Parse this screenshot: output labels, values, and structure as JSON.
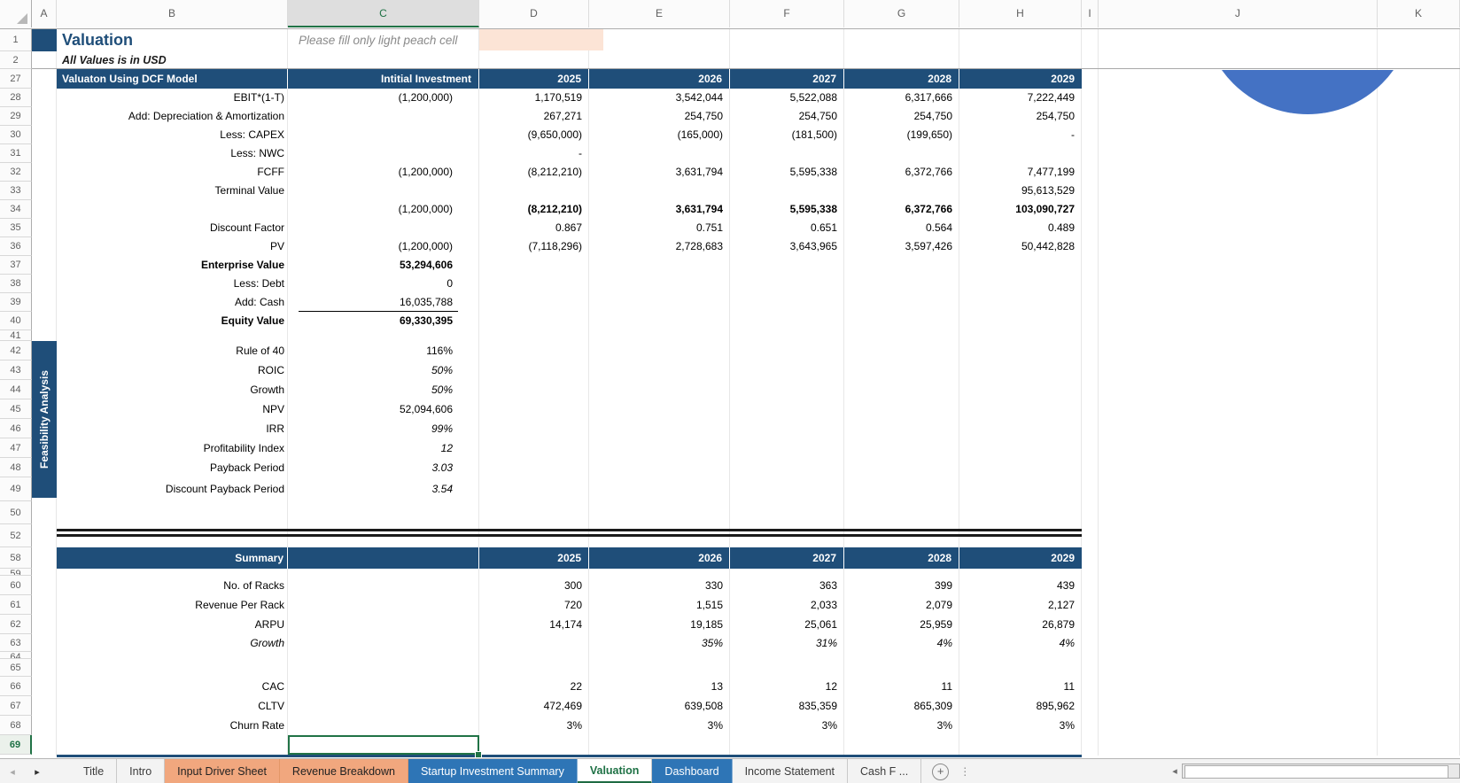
{
  "sheet": {
    "title": "Valuation",
    "subtitle": "All Values is in USD",
    "note": "Please fill only light peach cell",
    "column_headers": [
      "A",
      "B",
      "C",
      "D",
      "E",
      "F",
      "G",
      "H",
      "I",
      "J",
      "K"
    ],
    "selected_column": "C",
    "row_numbers": [
      "1",
      "2",
      "27",
      "28",
      "29",
      "30",
      "31",
      "32",
      "33",
      "34",
      "35",
      "36",
      "37",
      "38",
      "39",
      "40",
      "41",
      "42",
      "43",
      "44",
      "45",
      "46",
      "47",
      "48",
      "49",
      "50",
      "52",
      "58",
      "59",
      "60",
      "61",
      "62",
      "63",
      "64",
      "65",
      "66",
      "67",
      "68",
      "69"
    ],
    "selected_row": "69",
    "sidebar_label": "Feasibility Analysis"
  },
  "dcf_table": {
    "title": "Valuaton Using DCF Model",
    "initial_col_header": "Intitial Investment",
    "years": [
      "2025",
      "2026",
      "2027",
      "2028",
      "2029"
    ],
    "rows": [
      {
        "label": "EBIT*(1-T)",
        "initial": "(1,200,000)",
        "values": [
          "1,170,519",
          "3,542,044",
          "5,522,088",
          "6,317,666",
          "7,222,449"
        ]
      },
      {
        "label": "Add: Depreciation & Amortization",
        "initial": "",
        "values": [
          "267,271",
          "254,750",
          "254,750",
          "254,750",
          "254,750"
        ]
      },
      {
        "label": "Less: CAPEX",
        "initial": "",
        "values": [
          "(9,650,000)",
          "(165,000)",
          "(181,500)",
          "(199,650)",
          "-"
        ]
      },
      {
        "label": "Less: NWC",
        "initial": "",
        "values": [
          "-",
          "",
          "",
          "",
          ""
        ]
      },
      {
        "label": "FCFF",
        "initial": "(1,200,000)",
        "values": [
          "(8,212,210)",
          "3,631,794",
          "5,595,338",
          "6,372,766",
          "7,477,199"
        ]
      },
      {
        "label": "Terminal Value",
        "initial": "",
        "values": [
          "",
          "",
          "",
          "",
          "95,613,529"
        ]
      },
      {
        "label": "",
        "initial": "(1,200,000)",
        "values": [
          "(8,212,210)",
          "3,631,794",
          "5,595,338",
          "6,372,766",
          "103,090,727"
        ],
        "bold_values": true
      },
      {
        "label": "Discount Factor",
        "initial": "",
        "values": [
          "0.867",
          "0.751",
          "0.651",
          "0.564",
          "0.489"
        ]
      },
      {
        "label": "PV",
        "initial": "(1,200,000)",
        "values": [
          "(7,118,296)",
          "2,728,683",
          "3,643,965",
          "3,597,426",
          "50,442,828"
        ]
      }
    ]
  },
  "valuation_metrics": [
    {
      "label": "Enterprise Value",
      "value": "53,294,606",
      "bold": true
    },
    {
      "label": "Less: Debt",
      "value": "0"
    },
    {
      "label": "Add: Cash",
      "value": "16,035,788"
    },
    {
      "label": "Equity Value",
      "value": "69,330,395",
      "bold": true
    }
  ],
  "feasibility_metrics": [
    {
      "label": "Rule of 40",
      "value": "116%"
    },
    {
      "label": "ROIC",
      "value": "50%",
      "italic": true
    },
    {
      "label": "Growth",
      "value": "50%",
      "italic": true
    },
    {
      "label": "NPV",
      "value": "52,094,606"
    },
    {
      "label": "IRR",
      "value": "99%",
      "italic": true
    },
    {
      "label": "Profitability Index",
      "value": "12",
      "italic": true
    },
    {
      "label": "Payback Period",
      "value": "3.03",
      "italic": true
    },
    {
      "label": "Discount Payback Period",
      "value": "3.54",
      "italic": true
    }
  ],
  "summary_table": {
    "title": "Summary",
    "years": [
      "2025",
      "2026",
      "2027",
      "2028",
      "2029"
    ],
    "rows": [
      {
        "label": "No. of Racks",
        "values": [
          "300",
          "330",
          "363",
          "399",
          "439"
        ]
      },
      {
        "label": "Revenue Per Rack",
        "values": [
          "720",
          "1,515",
          "2,033",
          "2,079",
          "2,127"
        ]
      },
      {
        "label": "ARPU",
        "values": [
          "14,174",
          "19,185",
          "25,061",
          "25,959",
          "26,879"
        ]
      },
      {
        "label": "Growth",
        "values": [
          "",
          "35%",
          "31%",
          "4%",
          "4%"
        ],
        "italic": true
      },
      {
        "label": "CAC",
        "values": [
          "22",
          "13",
          "12",
          "11",
          "11"
        ]
      },
      {
        "label": "CLTV",
        "values": [
          "472,469",
          "639,508",
          "835,359",
          "865,309",
          "895,962"
        ]
      },
      {
        "label": "Churn Rate",
        "values": [
          "3%",
          "3%",
          "3%",
          "3%",
          "3%"
        ]
      }
    ]
  },
  "tab_bar": {
    "tabs": [
      {
        "label": "Title",
        "style": "plain"
      },
      {
        "label": "Intro",
        "style": "plain"
      },
      {
        "label": "Input Driver Sheet",
        "style": "peach"
      },
      {
        "label": "Revenue Breakdown",
        "style": "peach"
      },
      {
        "label": "Startup Investment Summary",
        "style": "blue"
      },
      {
        "label": "Valuation",
        "style": "active"
      },
      {
        "label": "Dashboard",
        "style": "blue"
      },
      {
        "label": "Income Statement",
        "style": "plain"
      },
      {
        "label": "Cash F ...",
        "style": "plain"
      }
    ]
  },
  "icons": {
    "tab_nav_left": "◂",
    "tab_nav_right": "▸",
    "add_sheet": "+",
    "more_dots": "⋮",
    "scroll_left": "◂"
  },
  "colors": {
    "header_navy": "#1F4E79",
    "peach_fill": "#FCE4D6",
    "peach_tab": "#F1A77E",
    "blue_tab": "#2E75B6",
    "active_green": "#217346",
    "chart_blue": "#4472C4"
  }
}
